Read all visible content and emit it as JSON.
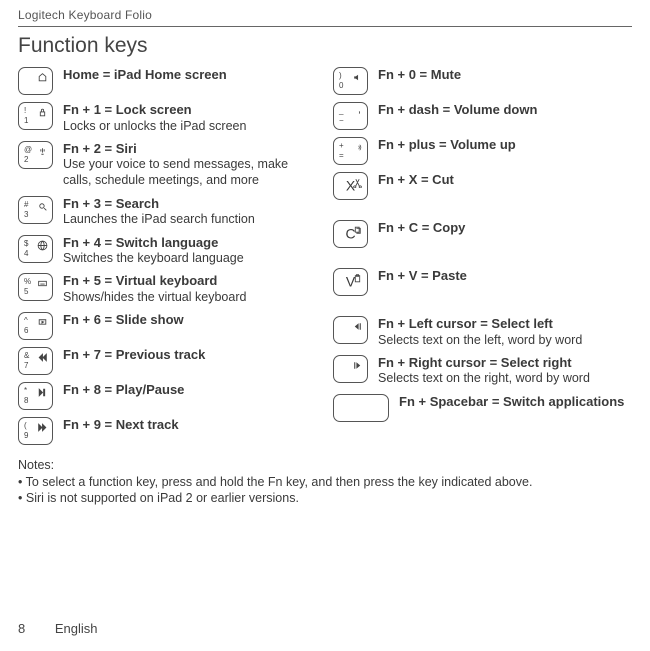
{
  "product_name": "Logitech Keyboard Folio",
  "page_title": "Function keys",
  "left": [
    {
      "tl": "",
      "bl": "",
      "tr": "",
      "center": "",
      "glyph": "home",
      "title": "Home = iPad Home screen",
      "desc": ""
    },
    {
      "tl": "!",
      "bl": "1",
      "glyph": "lock",
      "title": "Fn + 1 = Lock screen",
      "desc": "Locks or unlocks the iPad screen"
    },
    {
      "tl": "@",
      "bl": "2",
      "glyph": "siri",
      "title": "Fn + 2 = Siri",
      "desc": "Use your voice to send messages, make calls, schedule meetings, and more"
    },
    {
      "tl": "#",
      "bl": "3",
      "glyph": "search",
      "title": "Fn + 3 = Search",
      "desc": "Launches the iPad search function"
    },
    {
      "tl": "$",
      "bl": "4",
      "glyph": "globe",
      "title": "Fn + 4 = Switch language",
      "desc": "Switches the keyboard language"
    },
    {
      "tl": "%",
      "bl": "5",
      "glyph": "keyboard",
      "title": "Fn + 5 = Virtual keyboard",
      "desc": "Shows/hides the virtual keyboard"
    },
    {
      "tl": "^",
      "bl": "6",
      "glyph": "slideshow",
      "title": "Fn + 6 = Slide show",
      "desc": ""
    },
    {
      "tl": "&",
      "bl": "7",
      "glyph": "prev",
      "title": "Fn + 7 = Previous track",
      "desc": ""
    },
    {
      "tl": "*",
      "bl": "8",
      "glyph": "playpause",
      "title": "Fn + 8 = Play/Pause",
      "desc": ""
    },
    {
      "tl": "(",
      "bl": "9",
      "glyph": "next",
      "title": "Fn + 9 = Next track",
      "desc": ""
    }
  ],
  "right": [
    {
      "tl": ")",
      "bl": "0",
      "glyph": "mute",
      "title": "Fn + 0 = Mute",
      "desc": ""
    },
    {
      "tl": "_",
      "bl": "−",
      "glyph": "voldown",
      "title": "Fn + dash = Volume down",
      "desc": ""
    },
    {
      "tl": "+",
      "bl": "=",
      "glyph": "volup",
      "title": "Fn + plus = Volume up",
      "desc": ""
    },
    {
      "center": "X",
      "glyph": "cut",
      "title": "Fn + X = Cut",
      "desc": "",
      "tall": true
    },
    {
      "center": "C",
      "glyph": "copy",
      "title": "Fn + C = Copy",
      "desc": "",
      "tall": true
    },
    {
      "center": "V",
      "glyph": "paste",
      "title": "Fn + V = Paste",
      "desc": "",
      "tall": true
    },
    {
      "glyph": "selleft",
      "title": "Fn + Left cursor = Select left",
      "desc": "Selects text on the left, word by word",
      "pretall": true
    },
    {
      "glyph": "selright",
      "title": "Fn + Right cursor = Select right",
      "desc": "Selects text on the right, word by word"
    },
    {
      "wide": true,
      "title": "Fn + Spacebar = Switch applications",
      "desc": ""
    }
  ],
  "notes_label": "Notes:",
  "notes": [
    "To select a function key, press and hold the Fn key, and then press the key indicated above.",
    "Siri is not supported on iPad 2 or earlier versions."
  ],
  "footer": {
    "page": "8",
    "lang": "English"
  }
}
